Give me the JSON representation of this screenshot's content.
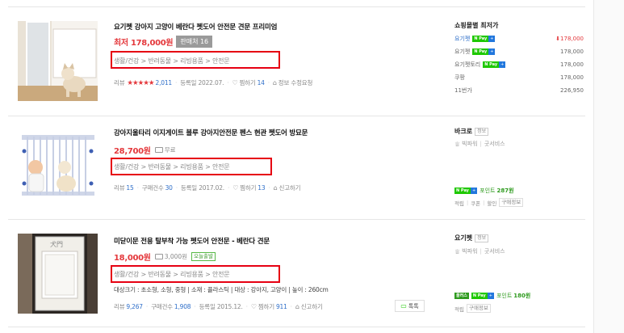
{
  "products": [
    {
      "title": "요기펫 강아지 고양이 베란다 펫도어 안전문 견문 프리미엄",
      "price": "최저 178,000원",
      "sale_badge": "판매처 16",
      "category": "생활/건강 > 반려동물 > 리빙용품 > 안전문",
      "meta": {
        "review_label": "리뷰",
        "stars": "★★★★★",
        "review_count": "2,011",
        "registered": "등록일 2022.07.",
        "wish_label": "찜하기",
        "wish_count": "14",
        "extra": "정보 수정요청"
      },
      "seller_panel": {
        "title": "쇼핑몰별 최저가",
        "malls": [
          {
            "name": "요기펫",
            "name_color": "#2f6fc9",
            "pay": true,
            "price": "178,000",
            "lowest": true
          },
          {
            "name": "요기펫",
            "name_color": "#666666",
            "pay": true,
            "price": "178,000",
            "lowest": false
          },
          {
            "name": "요기펫토리",
            "name_color": "#666666",
            "pay": true,
            "price": "178,000",
            "lowest": false
          },
          {
            "name": "쿠팡",
            "name_color": "#666666",
            "pay": false,
            "price": "178,000",
            "lowest": false
          },
          {
            "name": "11번가",
            "name_color": "#666666",
            "pay": false,
            "price": "226,950",
            "lowest": false
          }
        ]
      }
    },
    {
      "title": "강아지울타리 이지게이트 블루 강아지안전문 펜스 현관 펫도어 방묘문",
      "price": "28,700원",
      "shipping": "무료",
      "category": "생활/건강 > 반려동물 > 리빙용품 > 안전문",
      "meta": {
        "review_label": "리뷰",
        "review_count": "15",
        "purchase_label": "구매건수",
        "purchase_count": "30",
        "registered": "등록일 2017.02.",
        "wish_label": "찜하기",
        "wish_count": "13",
        "extra": "신고하기"
      },
      "seller_panel": {
        "title": "바크로",
        "info_badge": "정보",
        "grade": "빅파워",
        "service": "굿서비스",
        "point_label": "포인트",
        "point_value": "287원",
        "tags": [
          "적립",
          "쿠폰",
          "할인",
          "구매정보"
        ]
      }
    },
    {
      "title": "미닫이문 전용 탈부착 가능 펫도어 안전문 - 베란다 견문",
      "price": "18,000원",
      "shipping": "3,000원",
      "today_badge": "오늘출발",
      "category": "생활/건강 > 반려동물 > 리빙용품 > 안전문",
      "spec": "대상크기 : 초소형, 소형, 중형  |  소재 : 플라스틱  |  대상 : 강아지, 고양이  |  높이 : 260cm",
      "meta": {
        "review_label": "리뷰",
        "review_count": "9,267",
        "purchase_label": "구매건수",
        "purchase_count": "1,908",
        "registered": "등록일 2015.12.",
        "wish_label": "찜하기",
        "wish_count": "911",
        "extra": "신고하기"
      },
      "talk_label": "톡톡",
      "seller_panel": {
        "title": "요기펫",
        "info_badge": "정보",
        "grade": "빅파워",
        "service": "굿서비스",
        "prefix_badge": "플러스",
        "point_label": "포인트",
        "point_value": "180원",
        "tags": [
          "적립",
          "구매정보"
        ]
      }
    }
  ],
  "colors": {
    "price_red": "#e4383c",
    "link_blue": "#2f6fc9",
    "naver_green": "#1ec800",
    "highlight_red": "#e60012"
  },
  "icons": {
    "pay_badge": "naver-pay-icon",
    "heart": "heart-icon",
    "bell": "report-icon",
    "truck": "truck-icon",
    "medal": "medal-icon",
    "talk": "talk-bubble-icon"
  }
}
